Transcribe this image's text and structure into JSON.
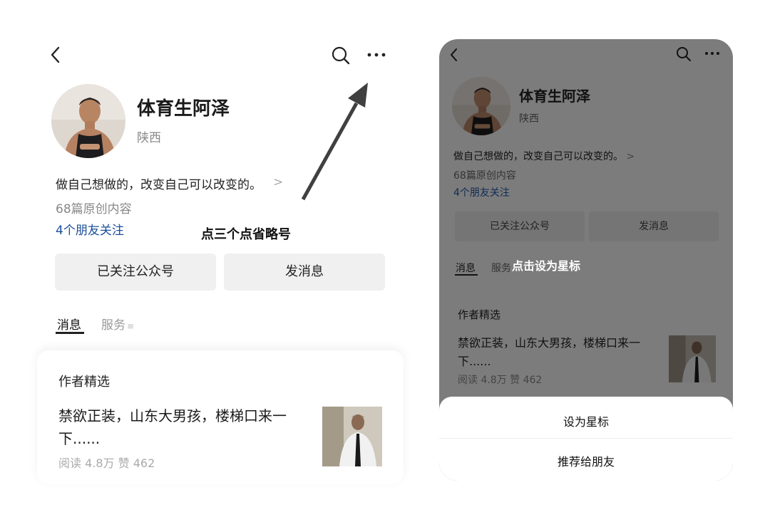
{
  "profile": {
    "name": "体育生阿泽",
    "region": "陕西",
    "bio": "做自己想做的，改变自己可以改变的。",
    "bio_chevron": ">",
    "article_count": "68篇原创内容",
    "friends_follow": "4个朋友关注"
  },
  "buttons": {
    "followed": "已关注公众号",
    "message": "发消息"
  },
  "tabs": {
    "messages": "消息",
    "services": "服务",
    "services_suffix": "≡"
  },
  "featured": {
    "section_title": "作者精选",
    "article_title": "禁欲正装，山东大男孩，楼梯口来一下......",
    "meta": "阅读 4.8万   赞 462"
  },
  "annotations": {
    "left_hint": "点三个点省略号",
    "right_hint": "点击设为星标"
  },
  "sheet": {
    "star": "设为星标",
    "recommend": "推荐给朋友"
  },
  "icons": {
    "back": "chevron-left-icon",
    "search": "search-icon",
    "more": "more-dots-icon"
  },
  "colors": {
    "link_blue": "#1b4e99",
    "overlay_gray": "#7c7c7c",
    "button_gray": "#f0f0f0",
    "arrow_gray": "#404040"
  }
}
